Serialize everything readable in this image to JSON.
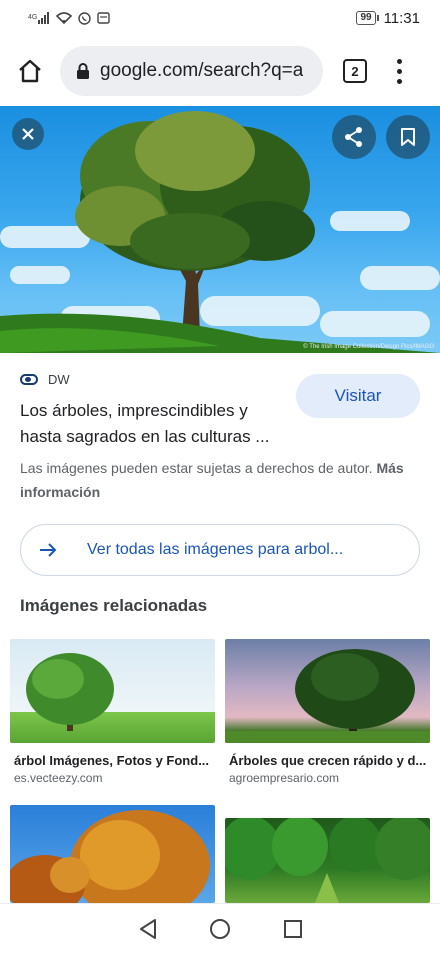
{
  "status_bar": {
    "time": "11:31",
    "battery": "99",
    "network": "4G"
  },
  "browser": {
    "url": "google.com/search?q=a",
    "tab_count": "2"
  },
  "hero": {
    "credit": "© The Irish Image Collection/Design Pics/IMAGO"
  },
  "result": {
    "source": "DW",
    "title": "Los árboles, imprescindibles y hasta sagrados en las culturas ...",
    "visit_label": "Visitar",
    "copyright_text": "Las imágenes pueden estar sujetas a derechos de autor.",
    "more_info_label": "Más información",
    "see_all_label": "Ver todas las imágenes para arbol..."
  },
  "related": {
    "heading": "Imágenes relacionadas",
    "items": [
      {
        "title": "árbol Imágenes, Fotos y Fond...",
        "domain": "es.vecteezy.com"
      },
      {
        "title": "Árboles que crecen rápido y d...",
        "domain": "agroempresario.com"
      },
      {
        "title": "",
        "domain": ""
      },
      {
        "title": "",
        "domain": ""
      }
    ]
  },
  "colors": {
    "accent": "#1a56b8",
    "visit_bg": "#e3ecfa"
  }
}
